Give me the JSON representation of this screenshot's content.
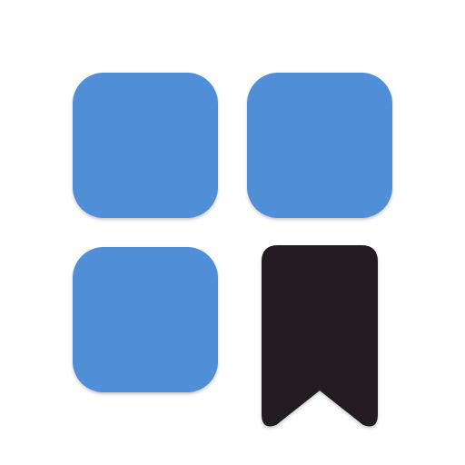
{
  "app_icon": {
    "name": "bookmarked-apps-grid-icon",
    "tiles": [
      {
        "name": "top-left-tile",
        "color": "#518ed8"
      },
      {
        "name": "top-right-tile",
        "color": "#518ed8"
      },
      {
        "name": "bottom-left-tile",
        "color": "#518ed8"
      }
    ],
    "bookmark": {
      "name": "bookmark-icon",
      "color": "#231f20"
    }
  },
  "colors": {
    "background": "#ffffff",
    "accent": "#518ed8",
    "dark": "#231f20"
  }
}
